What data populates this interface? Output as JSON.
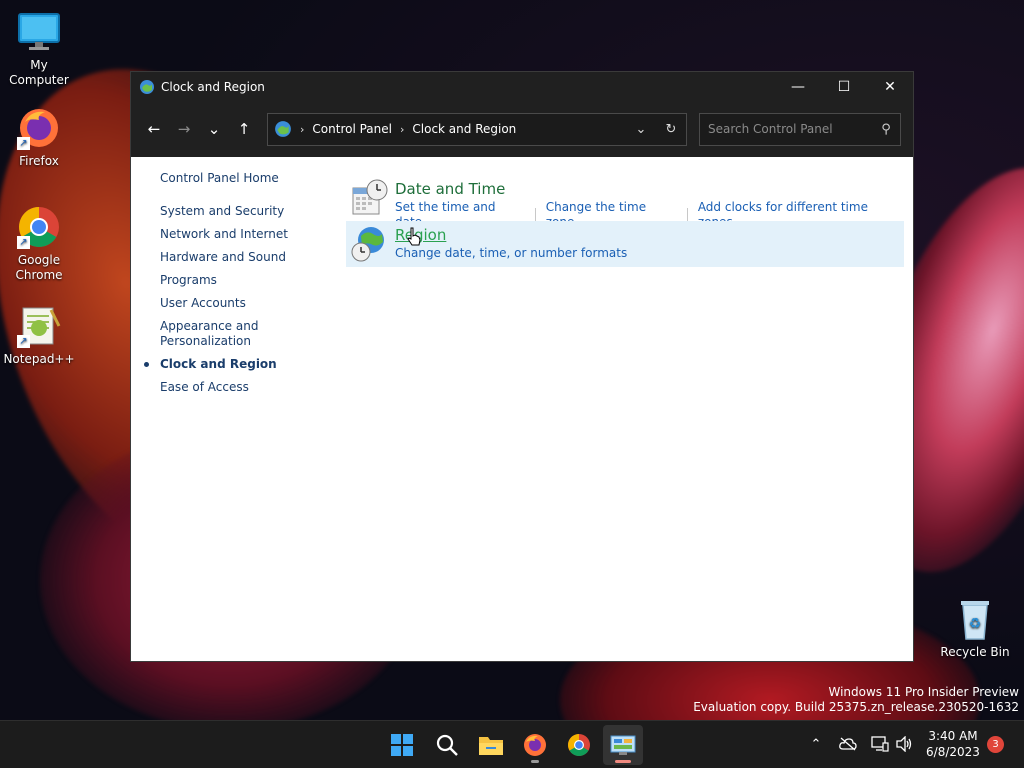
{
  "desktop": {
    "icons": [
      {
        "label": "My Computer",
        "icon": "monitor-icon"
      },
      {
        "label": "Firefox",
        "icon": "firefox-icon"
      },
      {
        "label": "Google Chrome",
        "icon": "chrome-icon"
      },
      {
        "label": "Notepad++",
        "icon": "notepadpp-icon"
      },
      {
        "label": "Recycle Bin",
        "icon": "recycle-bin-icon"
      }
    ],
    "watermark": {
      "line1": "Windows 11 Pro Insider Preview",
      "line2": "Evaluation copy. Build 25375.zn_release.230520-1632"
    }
  },
  "window": {
    "title": "Clock and Region",
    "controls": {
      "minimize": "—",
      "maximize": "☐",
      "close": "✕"
    },
    "nav": {
      "back": "←",
      "forward": "→",
      "recent": "⌄",
      "up": "↑"
    },
    "address": {
      "crumbs": [
        "Control Panel",
        "Clock and Region"
      ],
      "separator": "›"
    },
    "search": {
      "placeholder": "Search Control Panel"
    },
    "sidebar": {
      "home": "Control Panel Home",
      "items": [
        "System and Security",
        "Network and Internet",
        "Hardware and Sound",
        "Programs",
        "User Accounts",
        "Appearance and Personalization",
        "Clock and Region",
        "Ease of Access"
      ],
      "current_index": 6
    },
    "categories": [
      {
        "title": "Date and Time",
        "links": [
          "Set the time and date",
          "Change the time zone",
          "Add clocks for different time zones"
        ],
        "icon": "date-time-icon"
      },
      {
        "title": "Region",
        "links": [
          "Change date, time, or number formats"
        ],
        "icon": "region-globe-icon",
        "hover": true
      }
    ]
  },
  "taskbar": {
    "apps": [
      "start-icon",
      "search-icon",
      "file-explorer-icon",
      "firefox-icon",
      "chrome-icon",
      "control-panel-icon"
    ],
    "clock": {
      "time": "3:40 AM",
      "date": "6/8/2023"
    },
    "notification_count": "3"
  },
  "colors": {
    "link_blue": "#1a5fb4",
    "category_green": "#1e6e3a",
    "hover_bg": "#e3f1fa",
    "titlebar": "#202020"
  }
}
